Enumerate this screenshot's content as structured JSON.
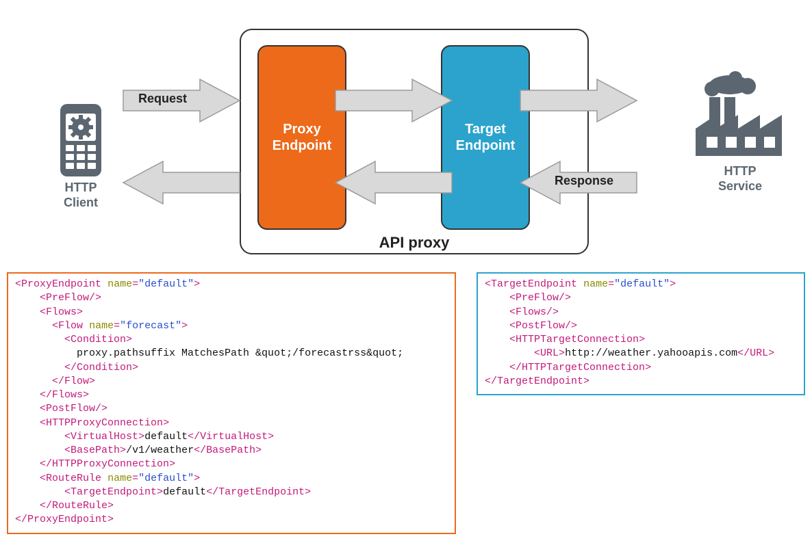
{
  "diagram": {
    "client_label_l1": "HTTP",
    "client_label_l2": "Client",
    "service_label_l1": "HTTP",
    "service_label_l2": "Service",
    "request_label": "Request",
    "response_label": "Response",
    "api_proxy_label": "API proxy",
    "proxy_box_l1": "Proxy",
    "proxy_box_l2": "Endpoint",
    "target_box_l1": "Target",
    "target_box_l2": "Endpoint"
  },
  "colors": {
    "proxy": "#ec6a1a",
    "target": "#2ba3cc",
    "icon_gray": "#5c6670",
    "arrow_gray": "#d6d6d6",
    "arrow_stroke": "#9a9a9a"
  },
  "proxy_code": {
    "root_tag": "ProxyEndpoint",
    "root_attr": "name",
    "root_val": "\"default\"",
    "preflow": "PreFlow",
    "flows": "Flows",
    "flow": "Flow",
    "flow_attr": "name",
    "flow_val": "\"forecast\"",
    "condition": "Condition",
    "condition_text": "proxy.pathsuffix MatchesPath &quot;/forecastrss&quot;",
    "postflow": "PostFlow",
    "httpproxy": "HTTPProxyConnection",
    "vhost": "VirtualHost",
    "vhost_text": "default",
    "basepath": "BasePath",
    "basepath_text": "/v1/weather",
    "routerule": "RouteRule",
    "routerule_attr": "name",
    "routerule_val": "\"default\"",
    "targetendpoint": "TargetEndpoint",
    "targetendpoint_text": "default"
  },
  "target_code": {
    "root_tag": "TargetEndpoint",
    "root_attr": "name",
    "root_val": "\"default\"",
    "preflow": "PreFlow",
    "flows": "Flows",
    "postflow": "PostFlow",
    "httpconn": "HTTPTargetConnection",
    "url": "URL",
    "url_text": "http://weather.yahooapis.com"
  }
}
